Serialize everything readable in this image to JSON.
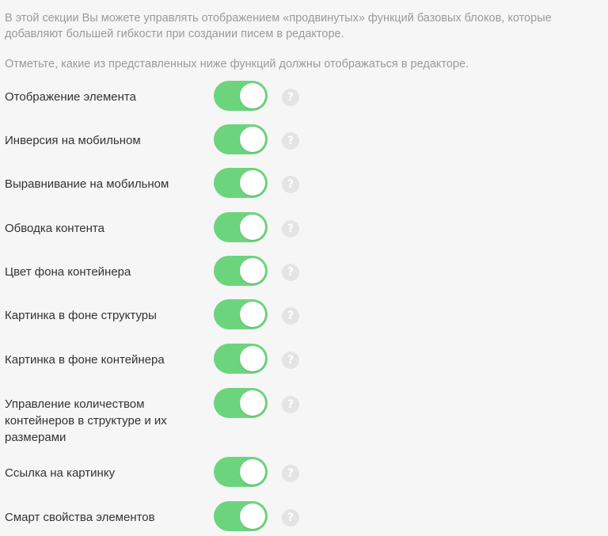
{
  "intro": "В этой секции Вы можете управлять отображением «продвинутых» функций базовых блоков, которые добавляют большей гибкости при создании писем в редакторе.",
  "hint": "Отметьте, какие из представленных ниже функций должны отображаться в редакторе.",
  "help_glyph": "?",
  "colors": {
    "toggle_on": "#6dd47e",
    "help_icon": "#e4e4e4",
    "muted_text": "#9a9a9a"
  },
  "features": [
    {
      "label": "Отображение элемента",
      "enabled": true
    },
    {
      "label": "Инверсия на мобильном",
      "enabled": true
    },
    {
      "label": "Выравнивание на мобильном",
      "enabled": true
    },
    {
      "label": "Обводка контента",
      "enabled": true
    },
    {
      "label": "Цвет фона контейнера",
      "enabled": true
    },
    {
      "label": "Картинка в фоне структуры",
      "enabled": true
    },
    {
      "label": "Картинка в фоне контейнера",
      "enabled": true
    },
    {
      "label": "Управление количеством контейнеров в структуре и их размерами",
      "enabled": true
    },
    {
      "label": "Ссылка на картинку",
      "enabled": true
    },
    {
      "label": "Смарт свойства элементов",
      "enabled": true
    }
  ]
}
